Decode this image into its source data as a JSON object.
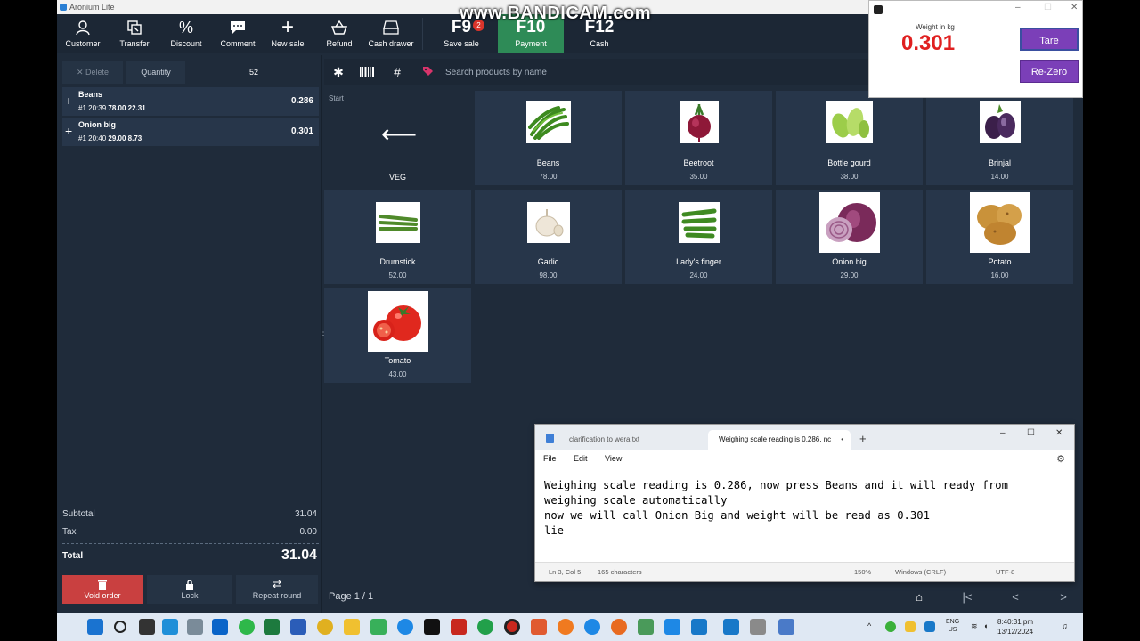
{
  "app": {
    "title": "Aronium Lite"
  },
  "watermark": "www.BANDICAM.com",
  "toolbar": {
    "buttons": [
      {
        "label": "Customer",
        "icon": "user-icon"
      },
      {
        "label": "Transfer",
        "icon": "transfer-icon"
      },
      {
        "label": "Discount",
        "icon": "percent-icon"
      },
      {
        "label": "Comment",
        "icon": "comment-icon"
      },
      {
        "label": "New sale",
        "icon": "plus-icon"
      },
      {
        "label": "Refund",
        "icon": "refund-icon"
      },
      {
        "label": "Cash drawer",
        "icon": "cash-drawer-icon"
      }
    ],
    "f9": {
      "key": "F9",
      "label": "Save sale",
      "badge": "2"
    },
    "f10": {
      "key": "F10",
      "label": "Payment"
    },
    "f12": {
      "key": "F12",
      "label": "Cash"
    }
  },
  "order": {
    "delete_label": "Delete",
    "quantity_label": "Quantity",
    "quantity_value": "52",
    "items": [
      {
        "name": "Beans",
        "meta_prefix": "#1 20:39",
        "price": "78.00",
        "total": "22.31",
        "qty": "0.286"
      },
      {
        "name": "Onion big",
        "meta_prefix": "#1 20:40",
        "price": "29.00",
        "total": "8.73",
        "qty": "0.301"
      }
    ],
    "subtotal_label": "Subtotal",
    "subtotal_value": "31.04",
    "tax_label": "Tax",
    "tax_value": "0.00",
    "total_label": "Total",
    "total_value": "31.04",
    "void_label": "Void order",
    "lock_label": "Lock",
    "repeat_label": "Repeat round"
  },
  "search": {
    "placeholder": "Search products by name"
  },
  "grid": {
    "start_label": "Start",
    "group_label": "VEG",
    "products": [
      {
        "name": "Beans",
        "price": "78.00",
        "icon": "beans-image"
      },
      {
        "name": "Beetroot",
        "price": "35.00",
        "icon": "beetroot-image"
      },
      {
        "name": "Bottle gourd",
        "price": "38.00",
        "icon": "bottle-gourd-image"
      },
      {
        "name": "Brinjal",
        "price": "14.00",
        "icon": "brinjal-image"
      },
      {
        "name": "Drumstick",
        "price": "52.00",
        "icon": "drumstick-image"
      },
      {
        "name": "Garlic",
        "price": "98.00",
        "icon": "garlic-image"
      },
      {
        "name": "Lady's finger",
        "price": "24.00",
        "icon": "ladys-finger-image"
      },
      {
        "name": "Onion big",
        "price": "29.00",
        "icon": "onion-image"
      },
      {
        "name": "Potato",
        "price": "16.00",
        "icon": "potato-image"
      },
      {
        "name": "Tomato",
        "price": "43.00",
        "icon": "tomato-image"
      }
    ]
  },
  "pager": {
    "text": "Page 1 / 1"
  },
  "weight_window": {
    "label": "Weight in kg",
    "value": "0.301",
    "tare_label": "Tare",
    "rezero_label": "Re-Zero"
  },
  "notepad": {
    "tab1": "clarification to wera.txt",
    "tab2": "Weighing scale reading is 0.286, nc",
    "menu": [
      "File",
      "Edit",
      "View"
    ],
    "text": "Weighing scale reading is 0.286, now press Beans and it will ready from\nweighing scale automatically\nnow we will call Onion Big and weight will be read as 0.301\nlie",
    "status": {
      "position": "Ln 3, Col 5",
      "chars": "165 characters",
      "zoom": "150%",
      "eol": "Windows (CRLF)",
      "encoding": "UTF-8"
    }
  },
  "taskbar": {
    "lang_top": "ENG",
    "lang_bottom": "US",
    "time": "8:40:31 pm",
    "date": "13/12/2024"
  },
  "colors": {
    "background": "#1f2b3a",
    "tile": "#27364a",
    "payment_active": "#2e8b57",
    "void": "#c94040",
    "weight_value": "#e02020",
    "scale_buttons": "#7b3fb8"
  }
}
